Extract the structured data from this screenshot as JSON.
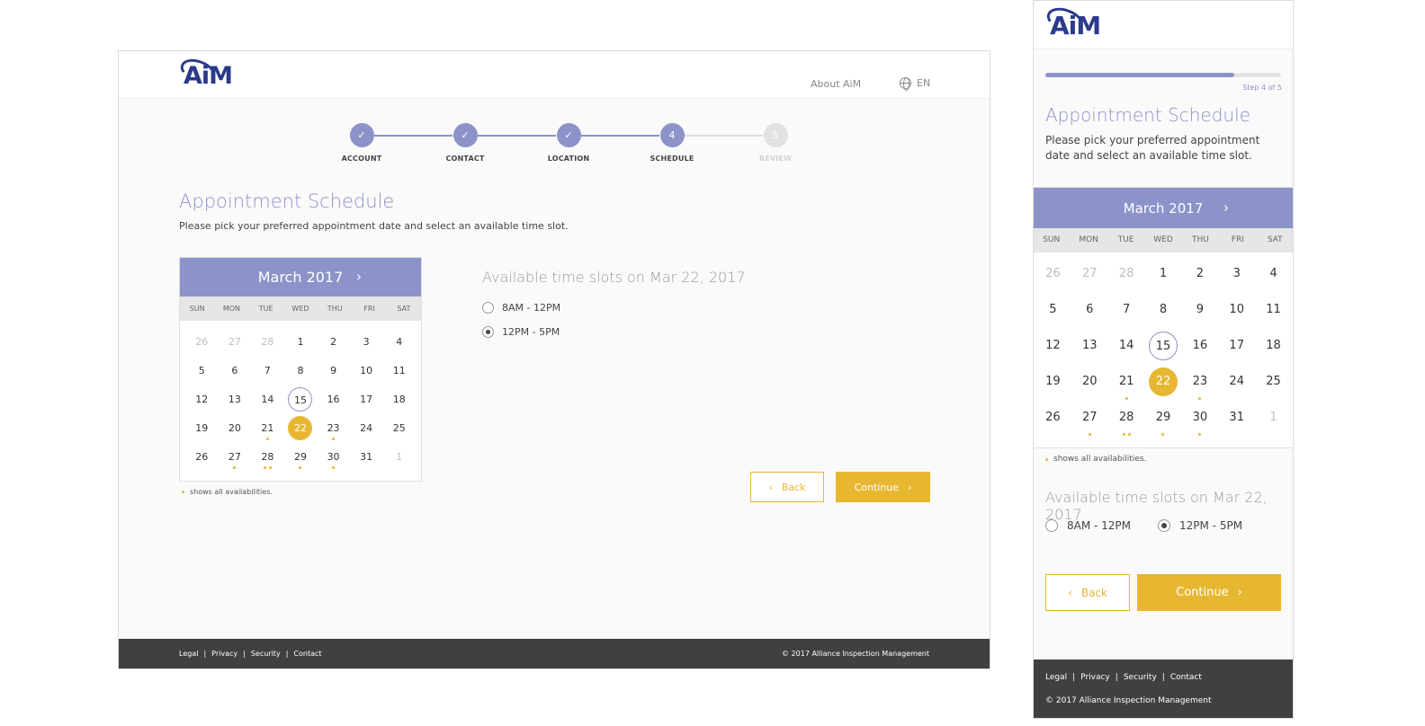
{
  "brand": {
    "logo_text": "AiM",
    "accent": "#8c93c9",
    "highlight": "#e8b731",
    "footer_bg": "#404040"
  },
  "desktop": {
    "nav": {
      "about": "About AiM",
      "lang": "EN"
    },
    "steps": [
      {
        "mark": "✓",
        "label": "ACCOUNT",
        "state": "done"
      },
      {
        "mark": "✓",
        "label": "CONTACT",
        "state": "done"
      },
      {
        "mark": "✓",
        "label": "LOCATION",
        "state": "done"
      },
      {
        "mark": "4",
        "label": "SCHEDULE",
        "state": "current"
      },
      {
        "mark": "5",
        "label": "REVIEW",
        "state": "todo"
      }
    ]
  },
  "mobile": {
    "step_text": "Step 4 of 5",
    "progress_fraction": 0.8
  },
  "page": {
    "title": "Appointment Schedule",
    "desc_desktop": "Please pick your preferred appointment date and select an available time slot.",
    "desc_mobile": "Please pick your preferred appointment date and select an available time slot."
  },
  "calendar": {
    "month": "March 2017",
    "next_icon": "chevron-right-icon",
    "dow": [
      "SUN",
      "MON",
      "TUE",
      "WED",
      "THU",
      "FRI",
      "SAT"
    ],
    "days": [
      {
        "d": "26",
        "m": true
      },
      {
        "d": "27",
        "m": true
      },
      {
        "d": "28",
        "m": true
      },
      {
        "d": "1"
      },
      {
        "d": "2"
      },
      {
        "d": "3"
      },
      {
        "d": "4"
      },
      {
        "d": "5"
      },
      {
        "d": "6"
      },
      {
        "d": "7"
      },
      {
        "d": "8"
      },
      {
        "d": "9"
      },
      {
        "d": "10"
      },
      {
        "d": "11"
      },
      {
        "d": "12"
      },
      {
        "d": "13"
      },
      {
        "d": "14"
      },
      {
        "d": "15",
        "today": true
      },
      {
        "d": "16"
      },
      {
        "d": "17"
      },
      {
        "d": "18"
      },
      {
        "d": "19"
      },
      {
        "d": "20"
      },
      {
        "d": "21",
        "dots": 1
      },
      {
        "d": "22",
        "selected": true
      },
      {
        "d": "23",
        "dots": 1
      },
      {
        "d": "24"
      },
      {
        "d": "25"
      },
      {
        "d": "26"
      },
      {
        "d": "27",
        "dots": 1
      },
      {
        "d": "28",
        "dots": 2
      },
      {
        "d": "29",
        "dots": 1
      },
      {
        "d": "30",
        "dots": 1
      },
      {
        "d": "31"
      },
      {
        "d": "1",
        "m": true
      }
    ],
    "legend": "shows all availabilities."
  },
  "slots": {
    "title": "Available time slots on Mar 22, 2017",
    "options": [
      {
        "label": "8AM - 12PM",
        "selected": false
      },
      {
        "label": "12PM - 5PM",
        "selected": true
      }
    ]
  },
  "buttons": {
    "back": "Back",
    "continue": "Continue",
    "back_icon": "‹",
    "continue_icon": "›"
  },
  "footer": {
    "links": [
      "Legal",
      "Privacy",
      "Security",
      "Contact"
    ],
    "separator": "|",
    "copyright": "© 2017 Alliance Inspection Management"
  }
}
